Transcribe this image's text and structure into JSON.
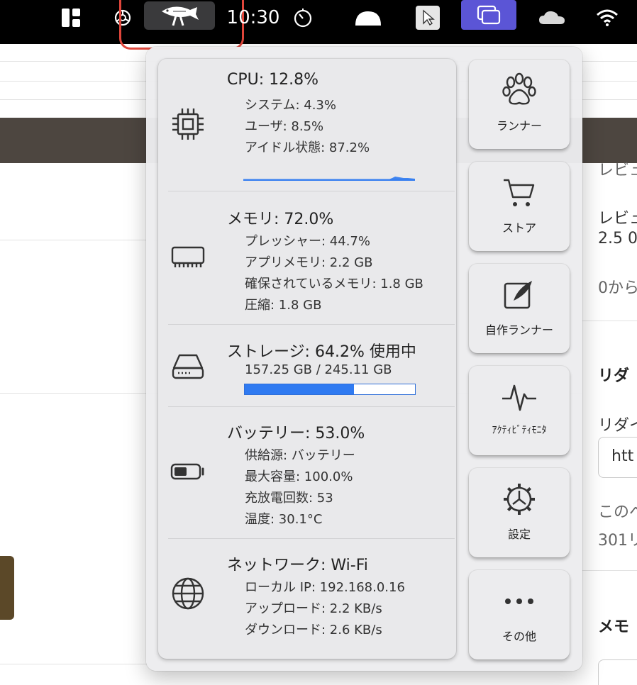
{
  "menubar": {
    "time": "10:30",
    "icons": [
      "apps-grid-icon",
      "openai-icon",
      "fish-runner-icon",
      "timer-icon",
      "cloud-mushroom-icon",
      "pointer-icon",
      "mission-control-icon",
      "onedrive-icon",
      "wifi-icon"
    ]
  },
  "background": {
    "right_texts": [
      "レビュ",
      "レビュ",
      "2.5 0",
      "0から",
      "リダ",
      "リダイ",
      "このへ",
      "301リ",
      "メモ"
    ],
    "input_value": "htt"
  },
  "stats": {
    "cpu": {
      "title": "CPU: 12.8%",
      "lines": [
        "システム:  4.3%",
        "ユーザ:  8.5%",
        "アイドル状態: 87.2%"
      ],
      "icon": "cpu-chip-icon"
    },
    "memory": {
      "title": "メモリ: 72.0%",
      "lines": [
        "プレッシャー: 44.7%",
        "アプリメモリ:  2.2 GB",
        "確保されているメモリ:  1.8 GB",
        "圧縮:  1.8 GB"
      ],
      "icon": "memory-module-icon"
    },
    "storage": {
      "title": "ストレージ: 64.2% 使用中",
      "detail": "157.25 GB / 245.11 GB",
      "used_fraction": 0.642,
      "icon": "hard-drive-icon"
    },
    "battery": {
      "title": "バッテリー:  53.0%",
      "lines": [
        "供給源: バッテリー",
        "最大容量: 100.0%",
        "充放電回数: 53",
        "温度: 30.1°C"
      ],
      "level_fraction": 0.53,
      "icon": "battery-icon"
    },
    "network": {
      "title": "ネットワーク: Wi-Fi",
      "lines": [
        "ローカル IP: 192.168.0.16",
        "アップロード:   2.2 KB/s",
        "ダウンロード:   2.6 KB/s"
      ],
      "icon": "globe-icon"
    }
  },
  "actions": [
    {
      "label": "ランナー",
      "icon": "paw-icon"
    },
    {
      "label": "ストア",
      "icon": "cart-icon"
    },
    {
      "label": "自作ランナー",
      "icon": "edit-feather-icon"
    },
    {
      "label": "ｱｸﾃｨﾋﾞﾃｨﾓﾆﾀ",
      "icon": "activity-pulse-icon"
    },
    {
      "label": "設定",
      "icon": "gear-icon"
    },
    {
      "label": "その他",
      "icon": "more-dots-icon"
    }
  ],
  "colors": {
    "accent_blue": "#2f7af1",
    "highlight_red": "#e0463b",
    "mission_purple": "#5b55d6"
  }
}
